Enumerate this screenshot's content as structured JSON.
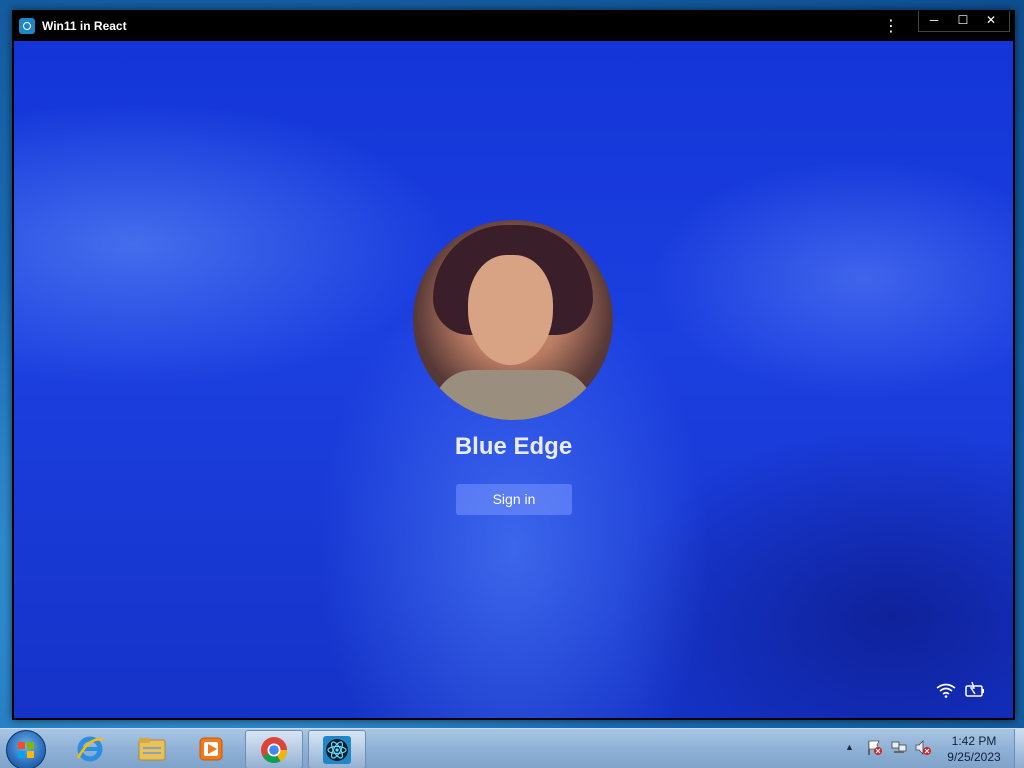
{
  "window": {
    "title": "Win11 in React",
    "menu_icon": "kebab-menu-icon",
    "minimize_symbol": "─",
    "maximize_symbol": "☐",
    "close_symbol": "✕"
  },
  "lockscreen": {
    "user_name": "Blue Edge",
    "signin_label": "Sign in",
    "status_icons": [
      "wifi-icon",
      "battery-icon"
    ]
  },
  "taskbar": {
    "pinned": [
      "internet-explorer-icon",
      "file-explorer-icon",
      "media-player-icon",
      "chrome-icon",
      "react-app-icon"
    ],
    "active_item": "react-app-icon",
    "tray_icons": [
      "action-center-flag-icon",
      "network-icon",
      "volume-muted-icon"
    ],
    "tray_arrow": "▲",
    "clock_time": "1:42 PM",
    "clock_date": "9/25/2023"
  },
  "colors": {
    "lockscreen_blue": "#1c3fe0",
    "taskbar": "#8fb1d6",
    "titlebar": "#000000"
  }
}
